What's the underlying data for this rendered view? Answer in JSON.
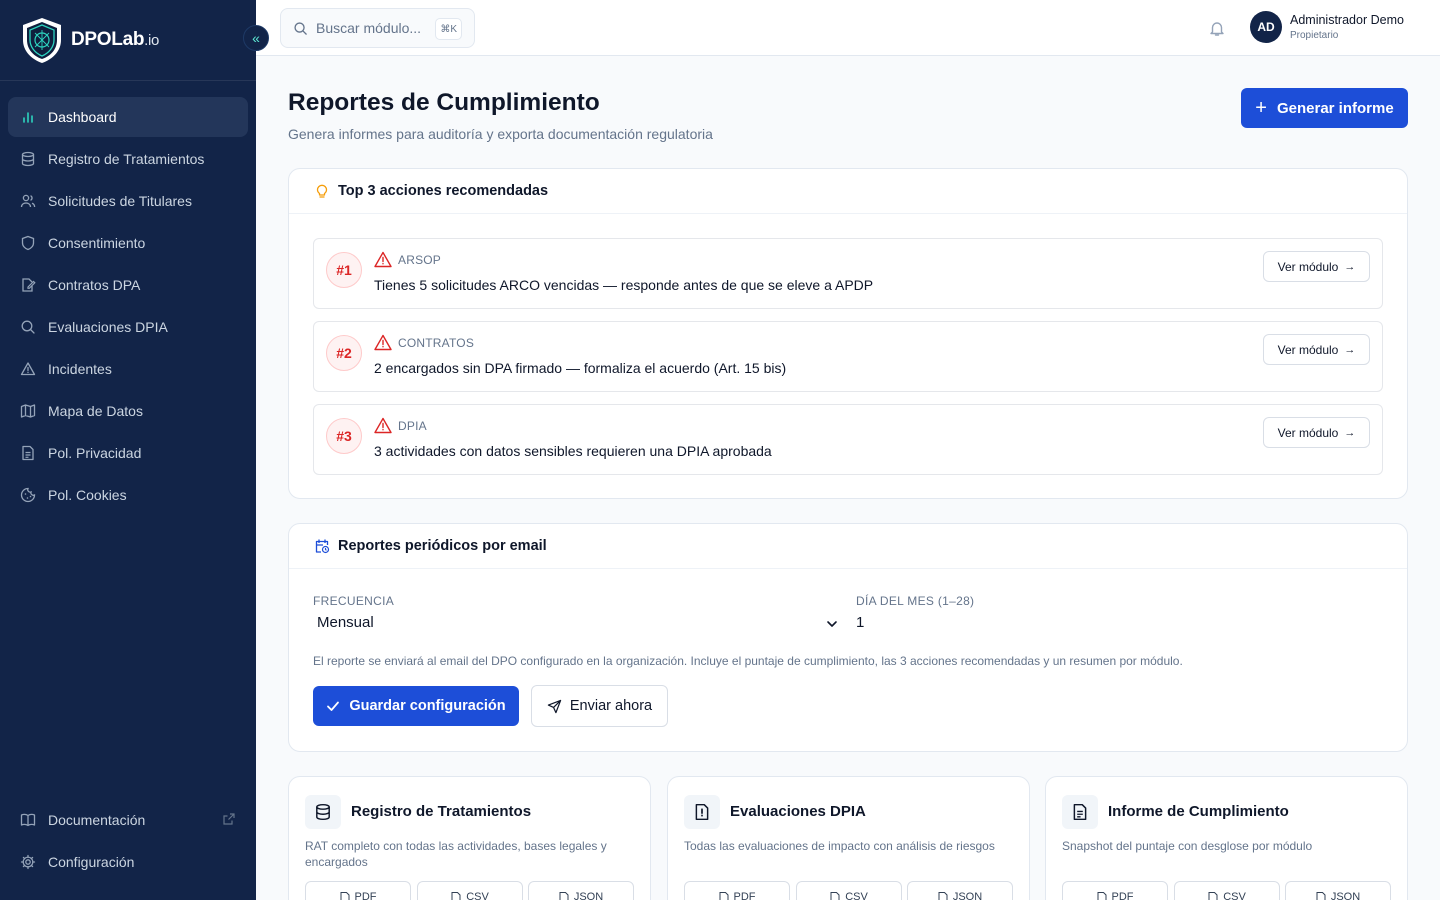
{
  "sidebar": {
    "brand": {
      "name": "DPOLab",
      "suffix": ".io"
    },
    "items": [
      {
        "label": "Dashboard",
        "icon": "bar-chart-icon",
        "active": true
      },
      {
        "label": "Registro de Tratamientos",
        "icon": "database-icon"
      },
      {
        "label": "Solicitudes de Titulares",
        "icon": "users-icon"
      },
      {
        "label": "Consentimiento",
        "icon": "shield-icon"
      },
      {
        "label": "Contratos DPA",
        "icon": "file-signature-icon"
      },
      {
        "label": "Evaluaciones DPIA",
        "icon": "search-icon"
      },
      {
        "label": "Incidentes",
        "icon": "warning-icon"
      },
      {
        "label": "Mapa de Datos",
        "icon": "map-icon"
      },
      {
        "label": "Pol. Privacidad",
        "icon": "file-text-icon"
      },
      {
        "label": "Pol. Cookies",
        "icon": "cookie-icon"
      }
    ],
    "bottom": [
      {
        "label": "Documentación",
        "icon": "book-icon"
      },
      {
        "label": "Configuración",
        "icon": "gear-icon"
      }
    ]
  },
  "topbar": {
    "search_placeholder": "Buscar módulo...",
    "shortcut": "⌘K",
    "user": {
      "initials": "AD",
      "name": "Administrador Demo",
      "role": "Propietario"
    }
  },
  "page": {
    "title": "Reportes de Cumplimiento",
    "subtitle": "Genera informes para auditoría y exporta documentación regulatoria",
    "generate_label": "Generar informe"
  },
  "recommended": {
    "title": "Top 3 acciones recomendadas",
    "button_label": "Ver módulo",
    "actions": [
      {
        "rank": "#1",
        "category": "ARSOP",
        "text": "Tienes 5 solicitudes ARCO vencidas — responde antes de que se eleve a APDP"
      },
      {
        "rank": "#2",
        "category": "CONTRATOS",
        "text": "2 encargados sin DPA firmado — formaliza el acuerdo (Art. 15 bis)"
      },
      {
        "rank": "#3",
        "category": "DPIA",
        "text": "3 actividades con datos sensibles requieren una DPIA aprobada"
      }
    ]
  },
  "email_reports": {
    "title": "Reportes periódicos por email",
    "frequency_label": "FRECUENCIA",
    "frequency_value": "Mensual",
    "day_label": "DÍA DEL MES (1–28)",
    "day_value": "1",
    "note": "El reporte se enviará al email del DPO configurado en la organización. Incluye el puntaje de cumplimiento, las 3 acciones recomendadas y un resumen por módulo.",
    "save_label": "Guardar configuración",
    "send_label": "Enviar ahora"
  },
  "exports": [
    {
      "title": "Registro de Tratamientos",
      "icon": "database-icon",
      "description": "RAT completo con todas las actividades, bases legales y encargados",
      "formats": [
        "PDF",
        "CSV",
        "JSON"
      ]
    },
    {
      "title": "Evaluaciones DPIA",
      "icon": "alert-file-icon",
      "description": "Todas las evaluaciones de impacto con análisis de riesgos",
      "formats": [
        "PDF",
        "CSV",
        "JSON"
      ]
    },
    {
      "title": "Informe de Cumplimiento",
      "icon": "file-text-icon",
      "description": "Snapshot del puntaje con desglose por módulo",
      "formats": [
        "PDF",
        "CSV",
        "JSON"
      ]
    }
  ],
  "colors": {
    "sidebar_bg": "#122448",
    "accent": "#1d4ed8",
    "danger": "#dc2626",
    "warning": "#f59e0b",
    "teal": "#2dd4bf"
  }
}
